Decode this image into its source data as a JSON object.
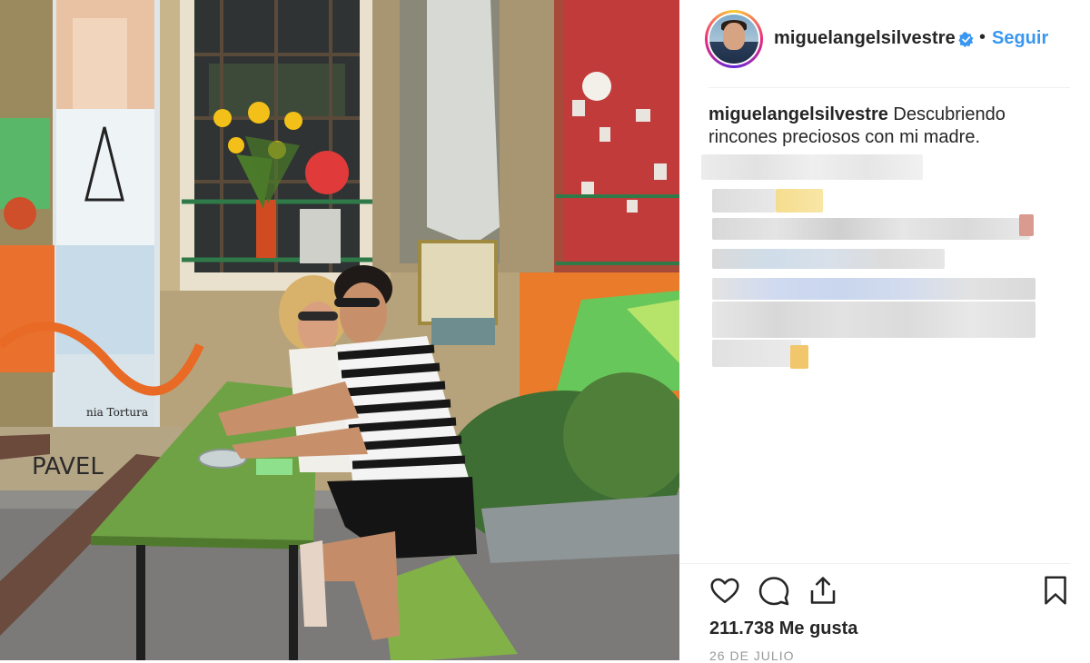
{
  "post": {
    "username": "miguelangelsilvestre",
    "separator": "•",
    "follow_label": "Seguir",
    "caption_user": "miguelangelsilvestre",
    "caption_text": " Descubriendo rincones preciosos con mi madre.",
    "likes": "211.738 Me gusta",
    "date": "26 DE JULIO"
  },
  "photo": {
    "wall_texts": [
      "PAVEL",
      "nia Tortura"
    ]
  },
  "icons": {
    "verified": "verified-badge-icon",
    "like": "heart-icon",
    "comment": "comment-bubble-icon",
    "share": "share-icon",
    "save": "bookmark-icon"
  },
  "colors": {
    "follow": "#3897f0",
    "verified": "#3897f0",
    "text": "#262626",
    "muted": "#999999"
  }
}
